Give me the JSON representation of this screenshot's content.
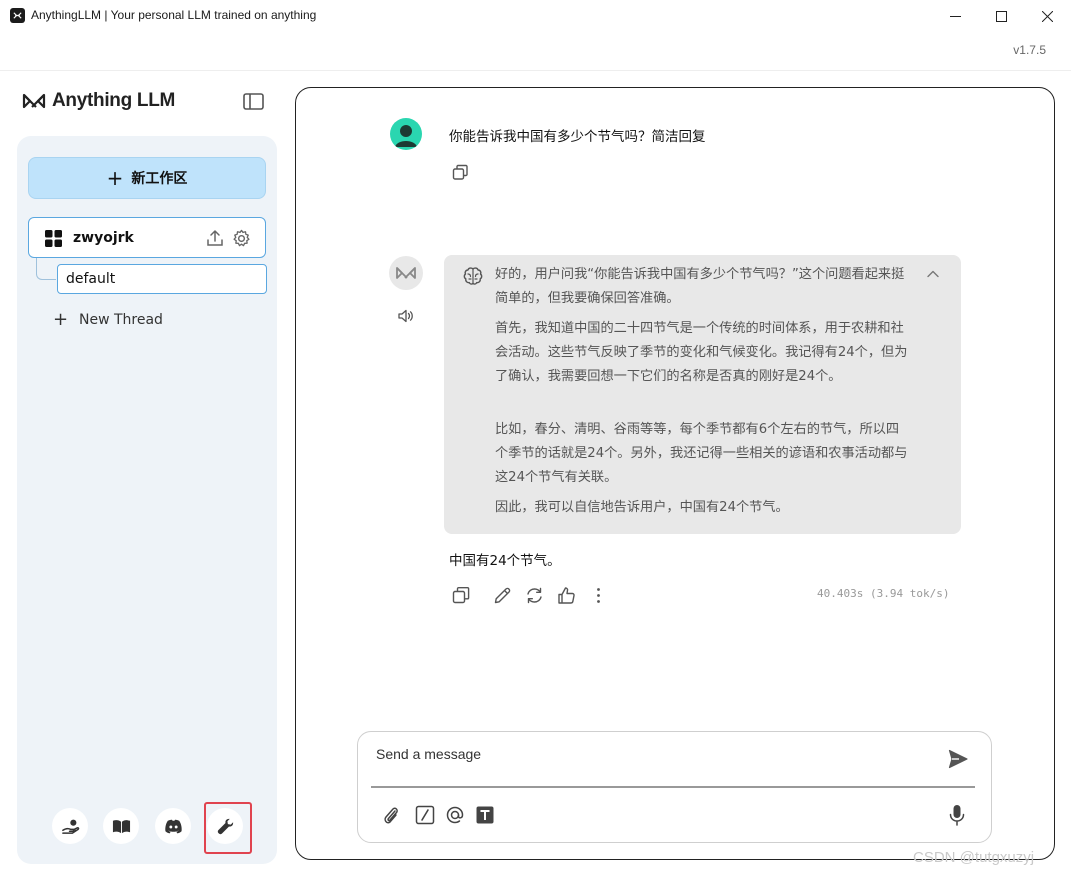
{
  "window": {
    "title": "AnythingLLM | Your personal LLM trained on anything",
    "version": "v1.7.5"
  },
  "sidebar": {
    "logo_text": "Anything LLM",
    "new_workspace_label": "新工作区",
    "workspace": {
      "name": "zwyojrk",
      "threads": [
        "default"
      ]
    },
    "new_thread_label": "New Thread",
    "footer_icons": [
      "community-hub-icon",
      "docs-book-icon",
      "discord-icon",
      "settings-wrench-icon"
    ]
  },
  "chat": {
    "user_message": "你能告诉我中国有多少个节气吗？简洁回复",
    "thinking": {
      "p1": "好的，用户问我“你能告诉我中国有多少个节气吗？”这个问题看起来挺简单的，但我要确保回答准确。",
      "p2": "首先，我知道中国的二十四节气是一个传统的时间体系，用于农耕和社会活动。这些节气反映了季节的变化和气候变化。我记得有24个，但为了确认，我需要回想一下它们的名称是否真的刚好是24个。",
      "p3": "比如，春分、清明、谷雨等等，每个季节都有6个左右的节气，所以四个季节的话就是24个。另外，我还记得一些相关的谚语和农事活动都与这24个节气有关联。",
      "p4": "因此，我可以自信地告诉用户，中国有24个节气。"
    },
    "answer": "中国有24个节气。",
    "timing": "40.403s (3.94 tok/s)"
  },
  "composer": {
    "placeholder": "Send a message"
  },
  "watermark": "CSDN @tutgxuzyj",
  "colors": {
    "accent": "#bfe3fb",
    "selected_border": "#5aa7e0",
    "highlight": "#e0434f",
    "avatar": "#2ad6b0"
  }
}
